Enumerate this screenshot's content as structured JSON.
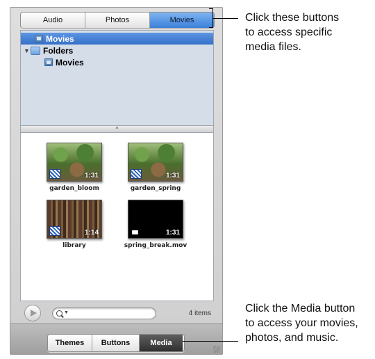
{
  "media_tabs": [
    "Audio",
    "Photos",
    "Movies"
  ],
  "tree": {
    "items": [
      {
        "label": "Movies",
        "icon": "folder-icon"
      },
      {
        "label": "Folders",
        "icon": "folders-icon"
      },
      {
        "label": "Movies",
        "icon": "folder-icon"
      }
    ]
  },
  "thumbnails": [
    {
      "name": "garden_bloom",
      "duration": "1:31",
      "badge": "clapboard-icon"
    },
    {
      "name": "garden_spring",
      "duration": "1:31",
      "badge": "clapboard-icon"
    },
    {
      "name": "library",
      "duration": "1:14",
      "badge": "clapboard-icon"
    },
    {
      "name": "spring_break.mov",
      "duration": "1:31",
      "badge": "camera-icon"
    }
  ],
  "search": {
    "value": "",
    "placeholder": ""
  },
  "item_count": "4 items",
  "bottom_tabs": [
    "Themes",
    "Buttons",
    "Media"
  ],
  "callouts": {
    "top": [
      "Click these buttons",
      "to access specific",
      "media files."
    ],
    "bottom": [
      "Click the Media button",
      "to access your movies,",
      "photos, and music."
    ]
  },
  "colors": {
    "selection_blue": "#3470c9",
    "active_dark": "#2f2f2f"
  }
}
